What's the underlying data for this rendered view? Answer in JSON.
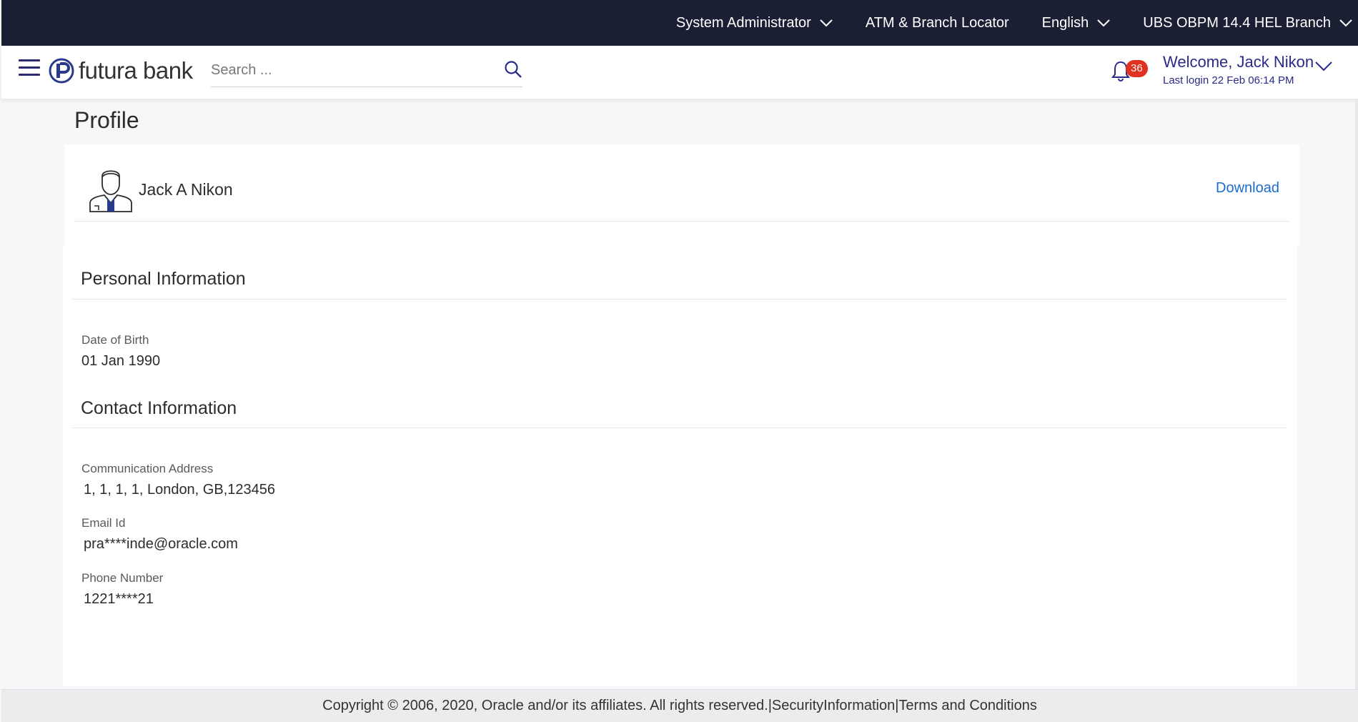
{
  "topbar": {
    "role": "System Administrator",
    "locator": "ATM & Branch Locator",
    "language": "English",
    "branch": "UBS OBPM 14.4 HEL Branch"
  },
  "header": {
    "logo_text": "futura bank",
    "search_placeholder": "Search ...",
    "notification_count": "36",
    "welcome": "Welcome, Jack Nikon",
    "last_login": "Last login 22 Feb 06:14 PM"
  },
  "page": {
    "title": "Profile"
  },
  "profile": {
    "name": "Jack A Nikon",
    "download_label": "Download"
  },
  "personal": {
    "title": "Personal Information",
    "dob_label": "Date of Birth",
    "dob_value": "01 Jan 1990"
  },
  "contact": {
    "title": "Contact Information",
    "address_label": "Communication Address",
    "address_value": "1, 1, 1, 1, London, GB,123456",
    "email_label": "Email Id",
    "email_value": "pra****inde@oracle.com",
    "phone_label": "Phone Number",
    "phone_value": "1221****21"
  },
  "footer": {
    "copyright": "Copyright © 2006, 2020, Oracle and/or its affiliates. All rights reserved.",
    "separator": "|",
    "security": "SecurityInformation",
    "terms": "Terms and Conditions"
  },
  "colors": {
    "topbar_bg": "#1a1f33",
    "brand_blue": "#2a2a8a",
    "link_blue": "#1a6dcc",
    "badge_red": "#e0301e"
  },
  "icons": {
    "menu": "hamburger-icon",
    "search": "search-icon",
    "notifications": "bell-icon",
    "dropdown": "chevron-down-icon",
    "avatar": "user-avatar-icon"
  }
}
